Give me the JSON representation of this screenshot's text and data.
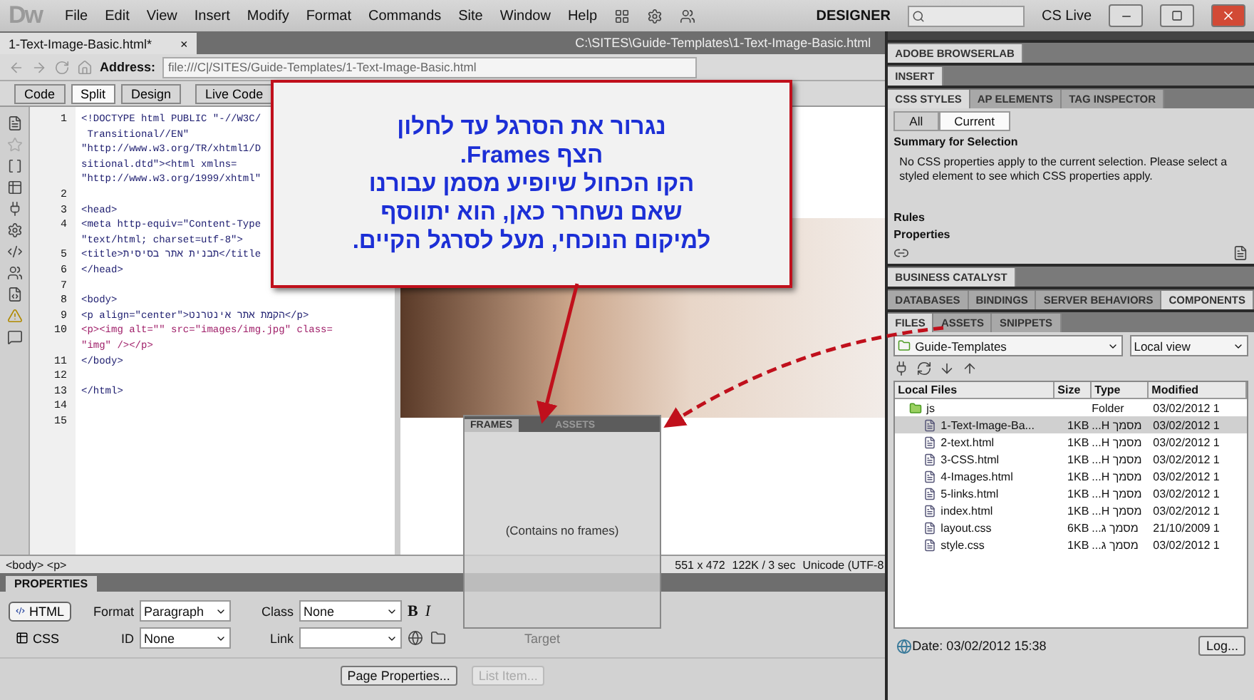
{
  "menubar": {
    "logo": "Dw",
    "menus": [
      "File",
      "Edit",
      "View",
      "Insert",
      "Modify",
      "Format",
      "Commands",
      "Site",
      "Window",
      "Help"
    ],
    "workspace": "DESIGNER",
    "cs_live": "CS Live"
  },
  "document": {
    "tab": "1-Text-Image-Basic.html*",
    "close": "×",
    "path": "C:\\SITES\\Guide-Templates\\1-Text-Image-Basic.html",
    "address_label": "Address:",
    "address": "file:///C|/SITES/Guide-Templates/1-Text-Image-Basic.html",
    "view_buttons": [
      {
        "label": "Code",
        "selected": false
      },
      {
        "label": "Split",
        "selected": true
      },
      {
        "label": "Design",
        "selected": false
      }
    ],
    "live_code": "Live Code"
  },
  "code_lines": [
    {
      "number": "1",
      "text": "<!DOCTYPE html PUBLIC \"-//W3C/"
    },
    {
      "text": " Transitional//EN\""
    },
    {
      "text": "\"http://www.w3.org/TR/xhtml1/D"
    },
    {
      "text": "sitional.dtd\"><html xmlns="
    },
    {
      "text": "\"http://www.w3.org/1999/xhtml\""
    },
    {
      "number": "2"
    },
    {
      "number": "3",
      "text": "<head>"
    },
    {
      "number": "4",
      "text": "<meta http-equiv=\"Content-Type"
    },
    {
      "text": "\"text/html; charset=utf-8\">"
    },
    {
      "number": "5",
      "text": "<title>תבנית אתר בסיסית</title"
    },
    {
      "number": "6",
      "text": "</head>"
    },
    {
      "number": "7"
    },
    {
      "number": "8",
      "text": "<body>"
    },
    {
      "number": "9",
      "text": "<p align=\"center\">הקמת אתר אינטרנט</p>"
    },
    {
      "number": "10",
      "text": "<p><img alt=\"\" src=\"images/img.jpg\" class="
    },
    {
      "text": "\"img\" /></p>"
    },
    {
      "number": "11",
      "text": "</body>"
    },
    {
      "number": "12"
    },
    {
      "number": "13",
      "text": "</html>"
    },
    {
      "number": "14"
    },
    {
      "number": "15"
    }
  ],
  "status_bar": {
    "tag_selector": "<body> <p>",
    "window_size": "551 x 472",
    "download": "122K / 3 sec",
    "encoding": "Unicode (UTF-8"
  },
  "properties": {
    "title": "PROPERTIES",
    "modes": [
      {
        "label": "HTML",
        "selected": true
      },
      {
        "label": "CSS",
        "selected": false
      }
    ],
    "format_label": "Format",
    "format": "Paragraph",
    "class_label": "Class",
    "class": "None",
    "bold": "B",
    "italic": "I",
    "id_label": "ID",
    "id": "None",
    "link_label": "Link",
    "target_label": "Target",
    "buttons": [
      {
        "label": "Page Properties...",
        "disabled": false
      },
      {
        "label": "List Item...",
        "disabled": true
      }
    ]
  },
  "panels": {
    "groups": [
      {
        "tabs": [
          {
            "label": "ADOBE BROWSERLAB",
            "selected": true
          }
        ]
      },
      {
        "tabs": [
          {
            "label": "INSERT",
            "selected": true
          }
        ]
      }
    ],
    "css": {
      "tabs": [
        {
          "label": "CSS STYLES",
          "selected": true
        },
        {
          "label": "AP ELEMENTS",
          "selected": false
        },
        {
          "label": "TAG INSPECTOR",
          "selected": false
        }
      ],
      "modes": [
        {
          "label": "All",
          "selected": false
        },
        {
          "label": "Current",
          "selected": true
        }
      ],
      "summary_title": "Summary for Selection",
      "summary": "No CSS properties apply to the current selection.  Please select a styled element to see which CSS properties apply.",
      "rules": "Rules",
      "properties": "Properties"
    },
    "groups2": [
      {
        "tabs": [
          {
            "label": "BUSINESS CATALYST",
            "selected": true
          }
        ]
      },
      {
        "tabs": [
          {
            "label": "DATABASES",
            "selected": false
          },
          {
            "label": "BINDINGS",
            "selected": false
          },
          {
            "label": "SERVER BEHAVIORS",
            "selected": false
          },
          {
            "label": "COMPONENTS",
            "selected": true
          }
        ]
      }
    ]
  },
  "files": {
    "tabs": [
      {
        "label": "FILES",
        "selected": true
      },
      {
        "label": "ASSETS",
        "selected": false
      },
      {
        "label": "SNIPPETS",
        "selected": false
      }
    ],
    "site": "Guide-Templates",
    "view": "Local view",
    "columns": [
      "Local Files",
      "Size",
      "Type",
      "Modified"
    ],
    "rows": [
      {
        "kind": "folder",
        "name": "js",
        "size": "",
        "type": "Folder",
        "modified": "03/02/2012 1",
        "selected": false
      },
      {
        "kind": "file",
        "name": "1-Text-Image-Ba...",
        "size": "1KB",
        "type": "מסמך H...",
        "modified": "03/02/2012 1",
        "selected": true
      },
      {
        "kind": "file",
        "name": "2-text.html",
        "size": "1KB",
        "type": "מסמך H...",
        "modified": "03/02/2012 1",
        "selected": false
      },
      {
        "kind": "file",
        "name": "3-CSS.html",
        "size": "1KB",
        "type": "מסמך H...",
        "modified": "03/02/2012 1",
        "selected": false
      },
      {
        "kind": "file",
        "name": "4-Images.html",
        "size": "1KB",
        "type": "מסמך H...",
        "modified": "03/02/2012 1",
        "selected": false
      },
      {
        "kind": "file",
        "name": "5-links.html",
        "size": "1KB",
        "type": "מסמך H...",
        "modified": "03/02/2012 1",
        "selected": false
      },
      {
        "kind": "file",
        "name": "index.html",
        "size": "1KB",
        "type": "מסמך H...",
        "modified": "03/02/2012 1",
        "selected": false
      },
      {
        "kind": "file",
        "name": "layout.css",
        "size": "6KB",
        "type": "מסמך ג...",
        "modified": "21/10/2009 1",
        "selected": false
      },
      {
        "kind": "file",
        "name": "style.css",
        "size": "1KB",
        "type": "מסמך ג...",
        "modified": "03/02/2012 1",
        "selected": false
      }
    ],
    "date": "Date: 03/02/2012 15:38",
    "log": "Log..."
  },
  "callout": {
    "lines": [
      "נגרור את הסרגל עד לחלון",
      "הצף Frames.",
      "הקו הכחול שיופיע מסמן עבורנו",
      "שאם נשחרר כאן, הוא יתווסף",
      "למיקום הנוכחי, מעל לסרגל הקיים."
    ]
  },
  "frames_panel": {
    "tab": "FRAMES",
    "ghost_tab": "ASSETS",
    "message": "(Contains no frames)"
  }
}
